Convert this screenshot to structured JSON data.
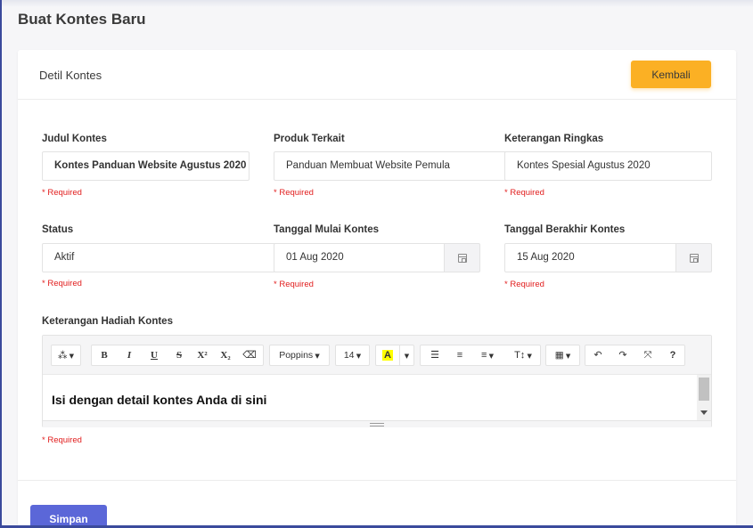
{
  "page_title": "Buat Kontes Baru",
  "card": {
    "title": "Detil Kontes",
    "back_button": "Kembali",
    "save_button": "Simpan"
  },
  "required_text": "* Required",
  "fields": {
    "judul": {
      "label": "Judul Kontes",
      "value": "Kontes Panduan Website Agustus 2020"
    },
    "produk": {
      "label": "Produk Terkait",
      "value": "Panduan Membuat Website Pemula"
    },
    "ringkas": {
      "label": "Keterangan Ringkas",
      "value": "Kontes Spesial Agustus 2020"
    },
    "status": {
      "label": "Status",
      "value": "Aktif"
    },
    "mulai": {
      "label": "Tanggal Mulai Kontes",
      "value": "01 Aug 2020"
    },
    "berakhir": {
      "label": "Tanggal Berakhir Kontes",
      "value": "15 Aug 2020"
    },
    "hadiah": {
      "label": "Keterangan Hadiah Kontes",
      "content": "Isi dengan detail kontes Anda di sini"
    }
  },
  "toolbar": {
    "magic": "⁂",
    "bold": "B",
    "italic": "I",
    "underline": "U",
    "strike": "S",
    "superscript": "X²",
    "subscript": "X₂",
    "eraser": "⌫",
    "font_name": "Poppins",
    "font_size": "14",
    "color": "A",
    "ol": "☰",
    "ul": "≡",
    "align": "≡",
    "height": "T↕",
    "table": "▦",
    "undo": "↶",
    "redo": "↷",
    "fullscreen": "⤧",
    "help": "?"
  },
  "colors": {
    "primary": "#5b67d8",
    "warning": "#fbb024",
    "required": "#e11d1d",
    "highlight": "#ffff00"
  }
}
